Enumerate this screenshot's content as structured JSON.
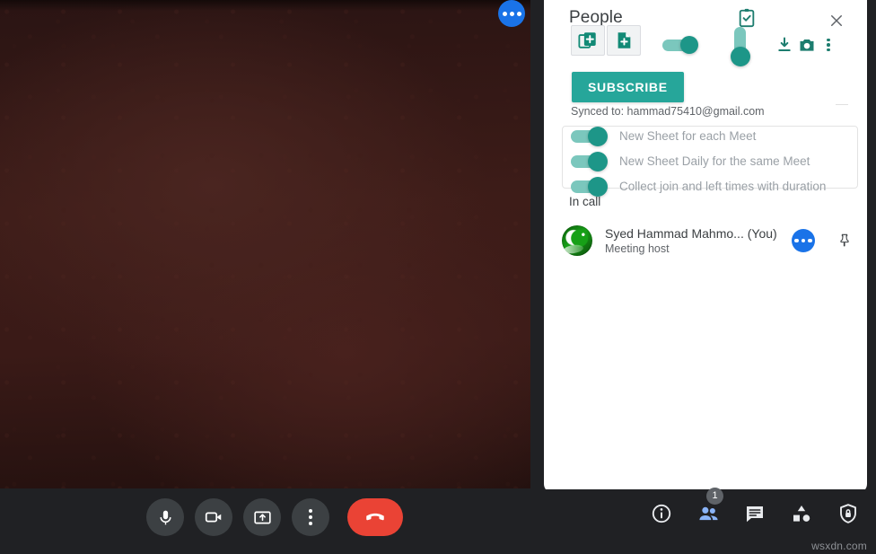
{
  "video": {
    "more_button_icon": "more-horizontal-icon"
  },
  "panel": {
    "title": "People",
    "close_icon": "close-icon",
    "clipboard_icon": "clipboard-check-icon",
    "addon": {
      "add_sheet_icon": "add-to-sheets-icon",
      "add_doc_icon": "add-document-icon",
      "horizontal_toggle_icon": "toggle-on-icon",
      "vertical_toggle_icon": "vertical-toggle-icon",
      "download_icon": "download-icon",
      "camera_icon": "camera-icon",
      "kebab_icon": "more-vertical-icon"
    },
    "subscribe_label": "SUBSCRIBE",
    "synced_text": "Synced to: hammad75410@gmail.com",
    "options": [
      {
        "label": "New Sheet for each Meet",
        "state": "on"
      },
      {
        "label": "New Sheet Daily for the same Meet",
        "state": "on"
      },
      {
        "label": "Collect join and left times with duration",
        "state": "on"
      }
    ],
    "section_label": "In call",
    "participants": [
      {
        "name": "Syed Hammad Mahmo...",
        "you_tag": "(You)",
        "role": "Meeting host",
        "more_icon": "more-horizontal-icon",
        "pin_icon": "pin-icon"
      }
    ]
  },
  "bottom_bar": {
    "controls": [
      {
        "name": "microphone",
        "icon": "microphone-icon"
      },
      {
        "name": "camera",
        "icon": "video-camera-icon"
      },
      {
        "name": "present-screen",
        "icon": "present-screen-icon"
      },
      {
        "name": "more-options",
        "icon": "more-vertical-icon"
      }
    ],
    "hangup": {
      "name": "leave-call",
      "icon": "phone-hangup-icon"
    },
    "right_controls": [
      {
        "name": "meeting-details",
        "icon": "info-icon",
        "badge": ""
      },
      {
        "name": "show-everyone",
        "icon": "people-icon",
        "badge": "1"
      },
      {
        "name": "chat",
        "icon": "chat-icon",
        "badge": ""
      },
      {
        "name": "activities",
        "icon": "activities-icon",
        "badge": ""
      },
      {
        "name": "host-controls",
        "icon": "shield-lock-icon",
        "badge": ""
      }
    ],
    "watermark": "wsxdn.com"
  },
  "colors": {
    "accent_teal": "#1d9688",
    "subscribe_teal": "#26a69a",
    "blue": "#1a73e8",
    "hangup_red": "#ea4335",
    "bar_dark": "#202124"
  }
}
